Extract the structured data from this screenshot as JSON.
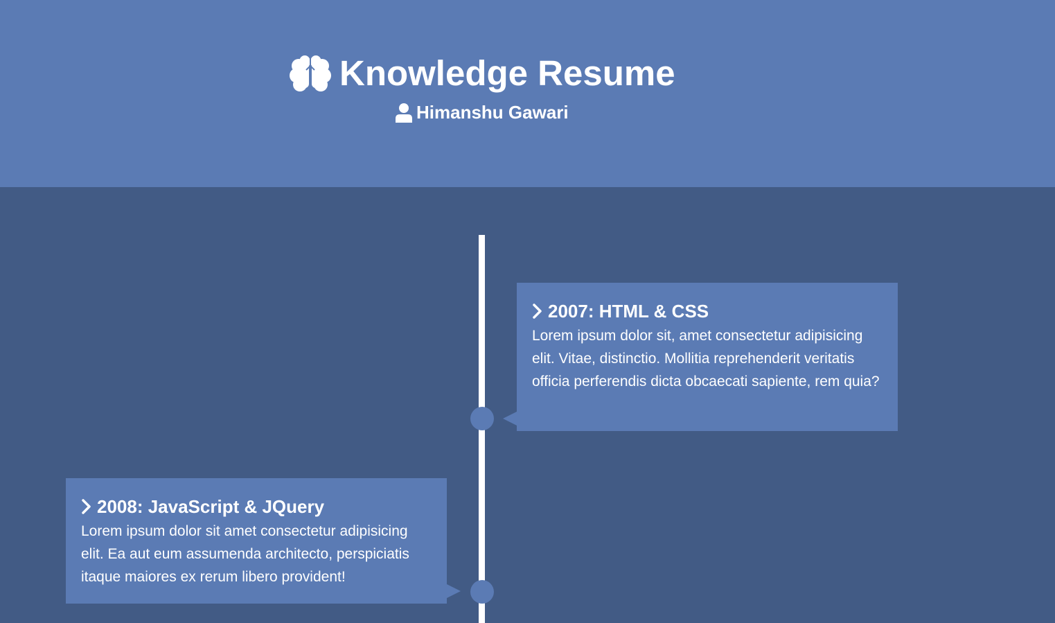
{
  "header": {
    "title": "Knowledge Resume",
    "title_icon": "brain-icon",
    "author": "Himanshu Gawari",
    "author_icon": "user-icon"
  },
  "timeline": {
    "entries": [
      {
        "side": "right",
        "icon": "chevron-right-icon",
        "heading": "2007: HTML & CSS",
        "body": "Lorem ipsum dolor sit, amet consectetur adipisicing elit. Vitae, distinctio. Mollitia reprehenderit veritatis officia perferendis dicta obcaecati sapiente, rem quia?"
      },
      {
        "side": "left",
        "icon": "chevron-right-icon",
        "heading": "2008: JavaScript & JQuery",
        "body": "Lorem ipsum dolor sit amet consectetur adipisicing elit. Ea aut eum assumenda architecto, perspiciatis itaque maiores ex rerum libero provident!"
      }
    ]
  },
  "colors": {
    "header_background": "#5b7bb4",
    "page_background": "#425b85",
    "card_background": "#5b7bb4",
    "line": "#ffffff",
    "text": "#ffffff"
  }
}
